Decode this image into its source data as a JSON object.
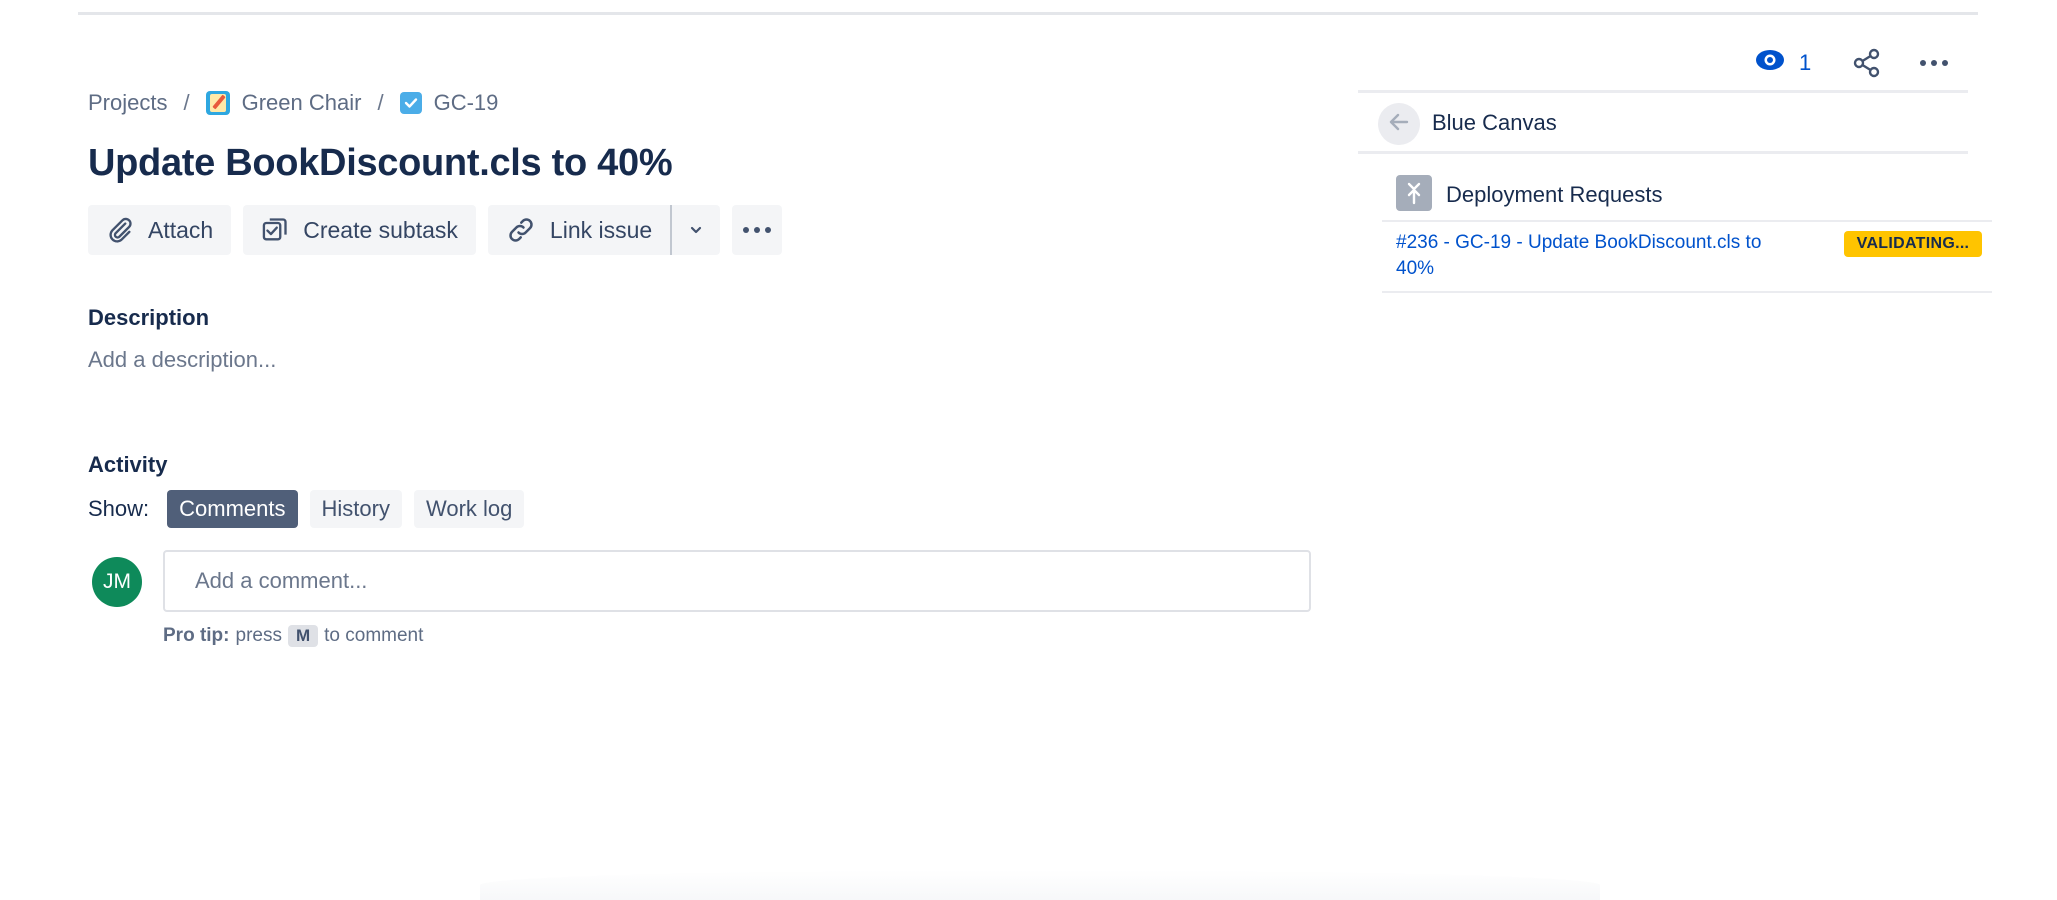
{
  "breadcrumb": {
    "projects": "Projects",
    "project": "Green Chair",
    "issue_key": "GC-19",
    "separator": "/"
  },
  "issue": {
    "title": "Update BookDiscount.cls to 40%"
  },
  "toolbar": {
    "attach": "Attach",
    "create_subtask": "Create subtask",
    "link_issue": "Link issue"
  },
  "description": {
    "label": "Description",
    "placeholder": "Add a description..."
  },
  "activity": {
    "label": "Activity",
    "show_label": "Show:",
    "tabs": [
      "Comments",
      "History",
      "Work log"
    ],
    "active_tab": "Comments",
    "avatar_initials": "JM",
    "comment_placeholder": "Add a comment...",
    "pro_tip_label": "Pro tip:",
    "pro_tip_before": "press",
    "pro_tip_key": "M",
    "pro_tip_after": "to comment"
  },
  "right_panel": {
    "watchers_count": "1",
    "canvas_name": "Blue Canvas",
    "section_title": "Deployment Requests",
    "request_link": "#236 - GC-19 - Update BookDiscount.cls to 40%",
    "status_badge": "VALIDATING..."
  },
  "colors": {
    "link": "#0052CC",
    "badge": "#FFC400",
    "avatar": "#0E8A5A",
    "active_chip": "#505F79"
  },
  "icons": [
    "project-icon",
    "task-icon",
    "paperclip-icon",
    "subtask-icon",
    "link-icon",
    "chevron-down-icon",
    "more-icon",
    "eye-icon",
    "share-icon",
    "back-arrow-icon",
    "deployment-icon"
  ]
}
